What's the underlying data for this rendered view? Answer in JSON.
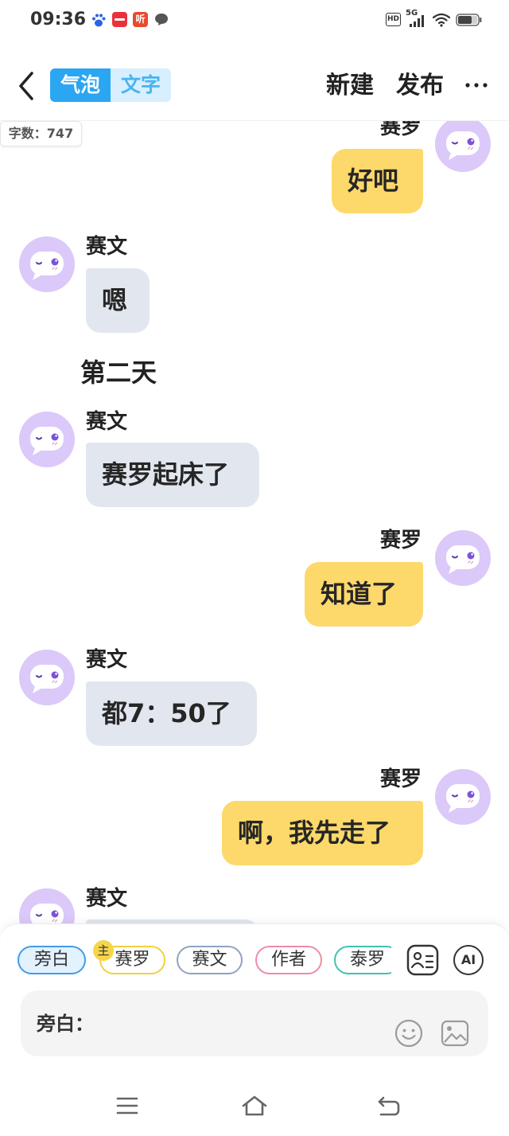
{
  "status_bar": {
    "time": "09:36",
    "notification_icons": [
      "baidu-icon",
      "xiaohongshu-icon",
      "ting-app-icon",
      "message-icon"
    ],
    "ting_glyph": "听",
    "hd_label": "HD",
    "network_label": "5G",
    "status_icons": [
      "signal-icon",
      "wifi-icon",
      "battery-icon"
    ]
  },
  "header": {
    "back_icon": "chevron-left-icon",
    "mode_tabs": [
      {
        "label": "气泡",
        "active": true
      },
      {
        "label": "文字",
        "active": false
      }
    ],
    "new_label": "新建",
    "publish_label": "发布",
    "more_icon": "more-horizontal-icon"
  },
  "word_count_badge": "字数：747",
  "messages": [
    {
      "speaker": "赛罗",
      "side": "right",
      "text": "好吧"
    },
    {
      "speaker": "赛文",
      "side": "left",
      "text": "嗯"
    },
    {
      "type": "narration",
      "text": "第二天"
    },
    {
      "speaker": "赛文",
      "side": "left",
      "text": "赛罗起床了"
    },
    {
      "speaker": "赛罗",
      "side": "right",
      "text": "知道了"
    },
    {
      "speaker": "赛文",
      "side": "left",
      "text": "都7：50了"
    },
    {
      "speaker": "赛罗",
      "side": "right",
      "text": "啊，我先走了"
    },
    {
      "speaker": "赛文",
      "side": "left"
    }
  ],
  "composer": {
    "roles": [
      {
        "label": "旁白",
        "selected": true,
        "color": "#3f9ce8"
      },
      {
        "label": "赛罗",
        "badge": "主",
        "color": "#f3d03e"
      },
      {
        "label": "赛文",
        "color": "#8fa3c0"
      },
      {
        "label": "作者",
        "color": "#ef8aa6"
      },
      {
        "label": "泰罗",
        "color": "#3fc2b0"
      }
    ],
    "role_manager_icon": "contact-card-icon",
    "ai_label": "AI",
    "input_prefix": "旁白：",
    "emoji_icon": "smiley-icon",
    "image_icon": "image-icon"
  },
  "nav_bar": {
    "icons": [
      "menu-icon",
      "home-icon",
      "back-icon"
    ]
  },
  "colors": {
    "accent_blue": "#2aa6f2",
    "tab_inactive_bg": "#d7efff",
    "tab_inactive_text": "#4ab3ef",
    "bubble_self": "#fdd86b",
    "bubble_other": "#e2e7ef",
    "avatar_bg": "#dbc9f9",
    "avatar_eye": "#7d52d8"
  }
}
